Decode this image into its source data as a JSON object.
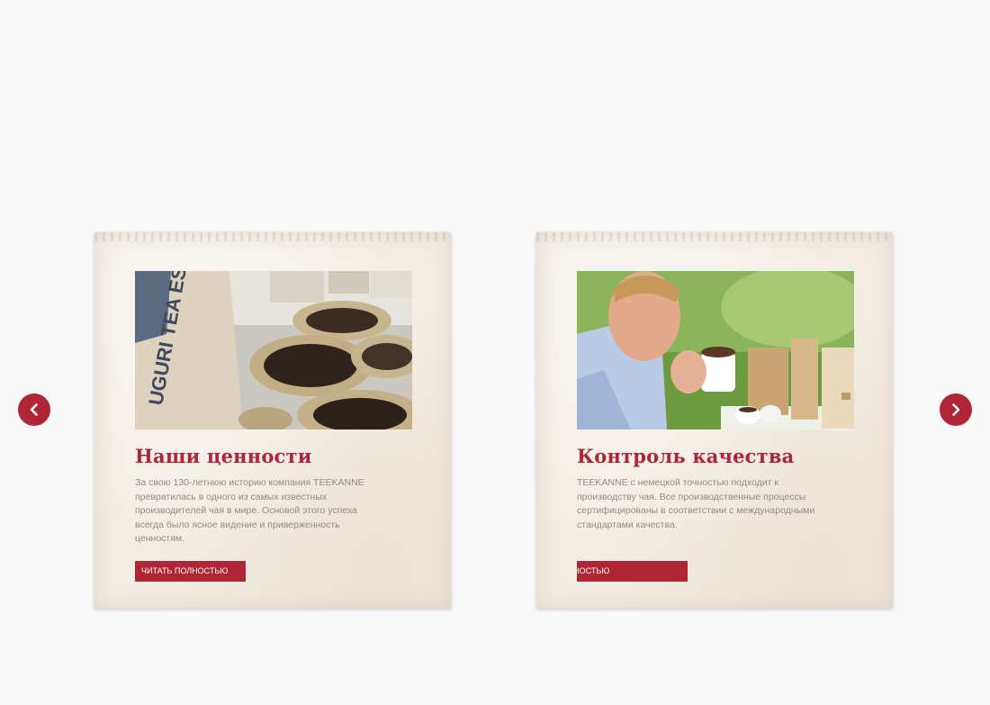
{
  "cards": [
    {
      "title": "Наши ценности",
      "text": "За свою 130-летнюю историю компания TEEKANNE превратилась в одного из самых известных производителей чая в мире. Основой этого успеха всегда было ясное видение и приверженность ценностям.",
      "button_label": "ЧИТАТЬ ПОЛНОСТЬЮ",
      "photo": "tea-samples-on-wicker-plates",
      "photo_sack_text": "UGURI TEA ESTATE"
    },
    {
      "title": "Контроль качества",
      "text": "TEEKANNE с немецкой точностью подходит к производству чая. Все производственные процессы сертифицированы в соответствии с международными стандартами качества.",
      "button_label": "ЧИТАТЬ ПОЛНОСТЬЮ",
      "photo": "man-smelling-tea-cup"
    }
  ],
  "navigation": {
    "prev_icon": "chevron-left-icon",
    "next_icon": "chevron-right-icon"
  },
  "colors": {
    "accent": "#b02535",
    "card_background": "#f3ede4",
    "body_text": "#8e8a86",
    "page_background": "#f9f9fa"
  }
}
